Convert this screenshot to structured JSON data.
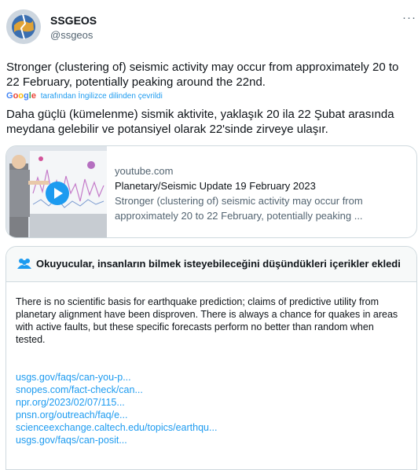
{
  "account": {
    "name": "SSGEOS",
    "handle": "@ssgeos"
  },
  "tweet": {
    "text": "Stronger (clustering of) seismic activity may occur from approximately 20 to 22 February, potentially peaking around the 22nd.",
    "translation_brand": "Google",
    "translation_note": "tarafından İngilizce dilinden çevrildi",
    "translated_text": "Daha güçlü (kümelenme) sismik aktivite, yaklaşık 20 ila 22 Şubat arasında meydana gelebilir ve potansiyel olarak 22'sinde zirveye ulaşır."
  },
  "link_card": {
    "domain": "youtube.com",
    "title": "Planetary/Seismic Update 19 February 2023",
    "description": "Stronger (clustering of) seismic activity may occur from approximately 20 to 22 February, potentially peaking ..."
  },
  "community_note": {
    "header": "Okuyucular, insanların bilmek isteyebileceğini düşündükleri içerikler ekledi",
    "body": "There is no scientific basis for earthquake prediction; claims of predictive utility from planetary alignment have been disproven. There is always a chance for quakes in areas with active faults, but these specific forecasts perform no better than random when tested.",
    "links": [
      "usgs.gov/faqs/can-you-p...",
      "snopes.com/fact-check/can...",
      "npr.org/2023/02/07/115...",
      "pnsn.org/outreach/faq/e...",
      "scienceexchange.caltech.edu/topics/earthqu...",
      "usgs.gov/faqs/can-posit..."
    ]
  },
  "colors": {
    "accent": "#1d9bf0",
    "secondary_text": "#536471",
    "border": "#cfd9de"
  },
  "icons": [
    "avatar-logo",
    "more-icon",
    "google-logo",
    "play-icon",
    "people-icon"
  ]
}
